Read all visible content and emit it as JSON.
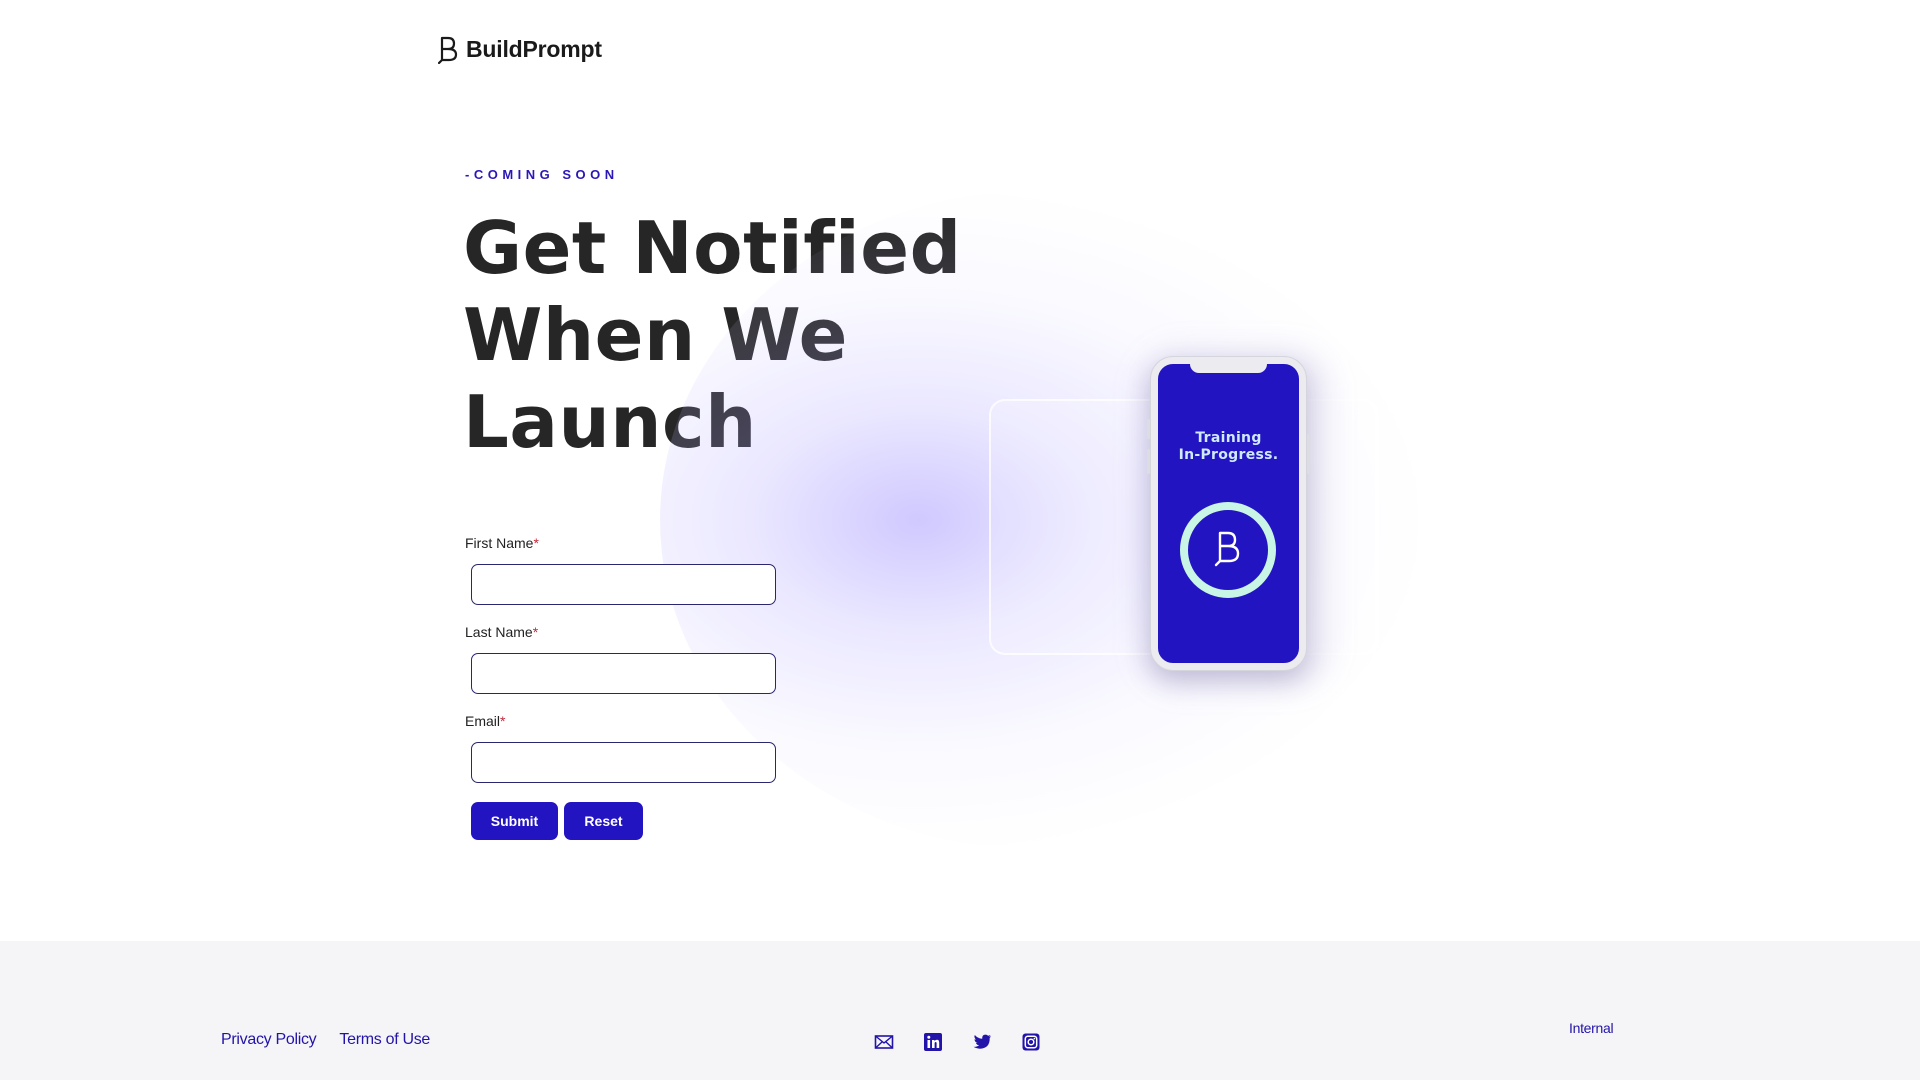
{
  "header": {
    "brand": "BuildPrompt",
    "logo_icon": "buildprompt-logo-icon"
  },
  "hero": {
    "eyebrow": "-COMING SOON",
    "headline": [
      "Get Notified",
      "When We",
      "Launch"
    ]
  },
  "form": {
    "fields": [
      {
        "label": "First Name",
        "required_mark": "*",
        "value": ""
      },
      {
        "label": "Last Name",
        "required_mark": "*",
        "value": ""
      },
      {
        "label": "Email",
        "required_mark": "*",
        "value": ""
      }
    ],
    "submit_label": "Submit",
    "reset_label": "Reset"
  },
  "phone": {
    "title_lines": [
      "Training",
      "In-Progress."
    ],
    "icon": "buildprompt-logo-icon"
  },
  "footer": {
    "links": [
      "Privacy Policy",
      "Terms of Use"
    ],
    "social_icons": [
      "mail-icon",
      "linkedin-icon",
      "twitter-icon",
      "instagram-icon"
    ],
    "internal_label": "Internal"
  },
  "colors": {
    "primary": "#2214c0",
    "accent_ring": "#c8f5e6",
    "headline": "#262626",
    "required": "#c4263b",
    "footer_bg": "#f5f5f7"
  }
}
